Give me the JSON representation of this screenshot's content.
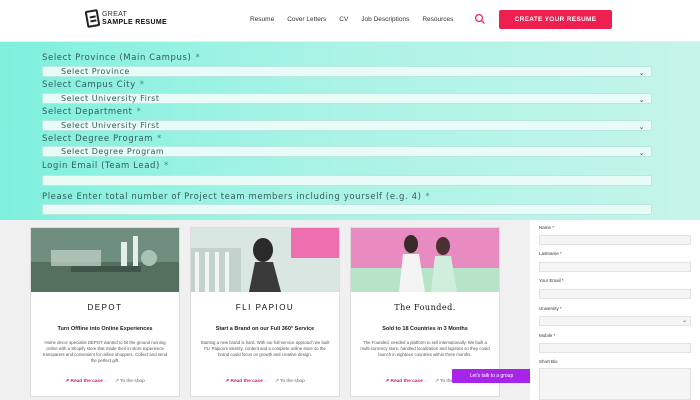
{
  "nav": {
    "logo_line1": "GREAT",
    "logo_line2": "SAMPLE RESUME",
    "links": [
      "Resume",
      "Cover Letters",
      "CV",
      "Job Descriptions",
      "Resources"
    ],
    "cta": "CREATE YOUR RESUME",
    "search_icon": "search-icon",
    "accent": "#ee2050"
  },
  "form": {
    "province_label": "Select Province (Main Campus)",
    "province_value": "Select Province",
    "city_label": "Select Campus City",
    "city_value": "Select University First",
    "department_label": "Select Department",
    "department_value": "Select University First",
    "degree_label": "Select Degree Program",
    "degree_value": "Select Degree Program",
    "email_label": "Login Email (Team Lead)",
    "members_label": "Please Enter total number of Project team members including yourself (e.g. 4)",
    "required_mark": "*"
  },
  "cards": [
    {
      "brand": "DEPOT",
      "tagline": "Turn Offline into Online Experiences",
      "desc": "Home decor specialist DEPOT wanted to hit the ground running online with a Shopify store that made their in-store experience transparent and convenient for online shoppers. Collect and send the perfect gift.",
      "read": "Read the case",
      "shop": "To the shop"
    },
    {
      "brand": "FLI PAPIOU",
      "tagline": "Start a Brand on our Full 360° Service",
      "desc": "Starting a new brand is hard. With our full-service approach we built FLI Papiou's identity, content and a complete online store so the brand could focus on growth and creative design.",
      "read": "Read the case",
      "shop": "To the shop"
    },
    {
      "brand": "The Founded.",
      "tagline": "Sold to 18 Countries in 3 Months",
      "desc": "The Founded. needed a platform to sell internationally. We built a multi-currency store, handled localization and logistics so they could launch in eighteen countries within three months.",
      "read": "Read the case",
      "shop": "To the shop"
    }
  ],
  "popup": "Let's talk to a group",
  "side": {
    "name": "Name *",
    "lastname": "Lastname *",
    "email": "Your Email *",
    "university": "University *",
    "mobile": "Mobile *",
    "bio": "Short Bio"
  }
}
